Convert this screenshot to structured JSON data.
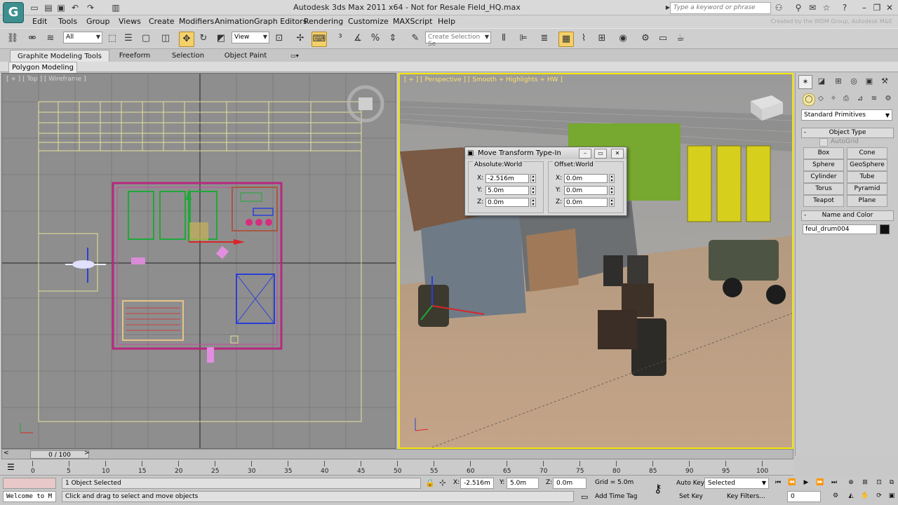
{
  "app": {
    "logo_glyph": "G",
    "title": "Autodesk 3ds Max 2011 x64    - Not for Resale   Field_HQ.max",
    "search_placeholder": "Type a keyword or phrase",
    "watermark": "Created by the WDM Group, Autodesk M&E"
  },
  "menu": [
    "Edit",
    "Tools",
    "Group",
    "Views",
    "Create",
    "Modifiers",
    "Animation",
    "Graph Editors",
    "Rendering",
    "Customize",
    "MAXScript",
    "Help"
  ],
  "toolbar": {
    "selection_filter": "All",
    "reference_coord": "View",
    "named_selection_placeholder": "Create Selection Se"
  },
  "ribbon": {
    "tabs": [
      "Graphite Modeling Tools",
      "Freeform",
      "Selection",
      "Object Paint"
    ],
    "panel": "Polygon Modeling"
  },
  "viewports": {
    "top_label": "[ + ] [ Top ] [ Wireframe ]",
    "persp_label": "[ + ] [ Perspective ] [ Smooth + Highlights + HW ]"
  },
  "move_dialog": {
    "title": "Move Transform Type-In",
    "absolute_group": "Absolute:World",
    "offset_group": "Offset:World",
    "absolute": {
      "x": "-2.516m",
      "y": "5.0m",
      "z": "0.0m"
    },
    "offset": {
      "x": "0.0m",
      "y": "0.0m",
      "z": "0.0m"
    },
    "axis_x": "X:",
    "axis_y": "Y:",
    "axis_z": "Z:"
  },
  "command_panel": {
    "category": "Standard Primitives",
    "object_type_title": "Object Type",
    "autogrid": "AutoGrid",
    "buttons": [
      "Box",
      "Cone",
      "Sphere",
      "GeoSphere",
      "Cylinder",
      "Tube",
      "Torus",
      "Pyramid",
      "Teapot",
      "Plane"
    ],
    "name_color_title": "Name and Color",
    "object_name": "feul_drum004",
    "object_color": "#111111"
  },
  "timeline": {
    "slider": "0 / 100",
    "ticks": [
      "0",
      "5",
      "10",
      "15",
      "20",
      "25",
      "30",
      "35",
      "40",
      "45",
      "50",
      "55",
      "60",
      "65",
      "70",
      "75",
      "80",
      "85",
      "90",
      "95",
      "100"
    ]
  },
  "status": {
    "maxscript_listener": "Welcome to M",
    "selection": "1 Object Selected",
    "prompt": "Click and drag to select and move objects",
    "x": "-2.516m",
    "y": "5.0m",
    "z": "0.0m",
    "x_label": "X:",
    "y_label": "Y:",
    "z_label": "Z:",
    "grid": "Grid = 5.0m",
    "add_time_tag": "Add Time Tag",
    "auto_key": "Auto Key",
    "set_key": "Set Key",
    "selected_dropdown": "Selected",
    "key_filters": "Key Filters...",
    "current_frame": "0"
  }
}
